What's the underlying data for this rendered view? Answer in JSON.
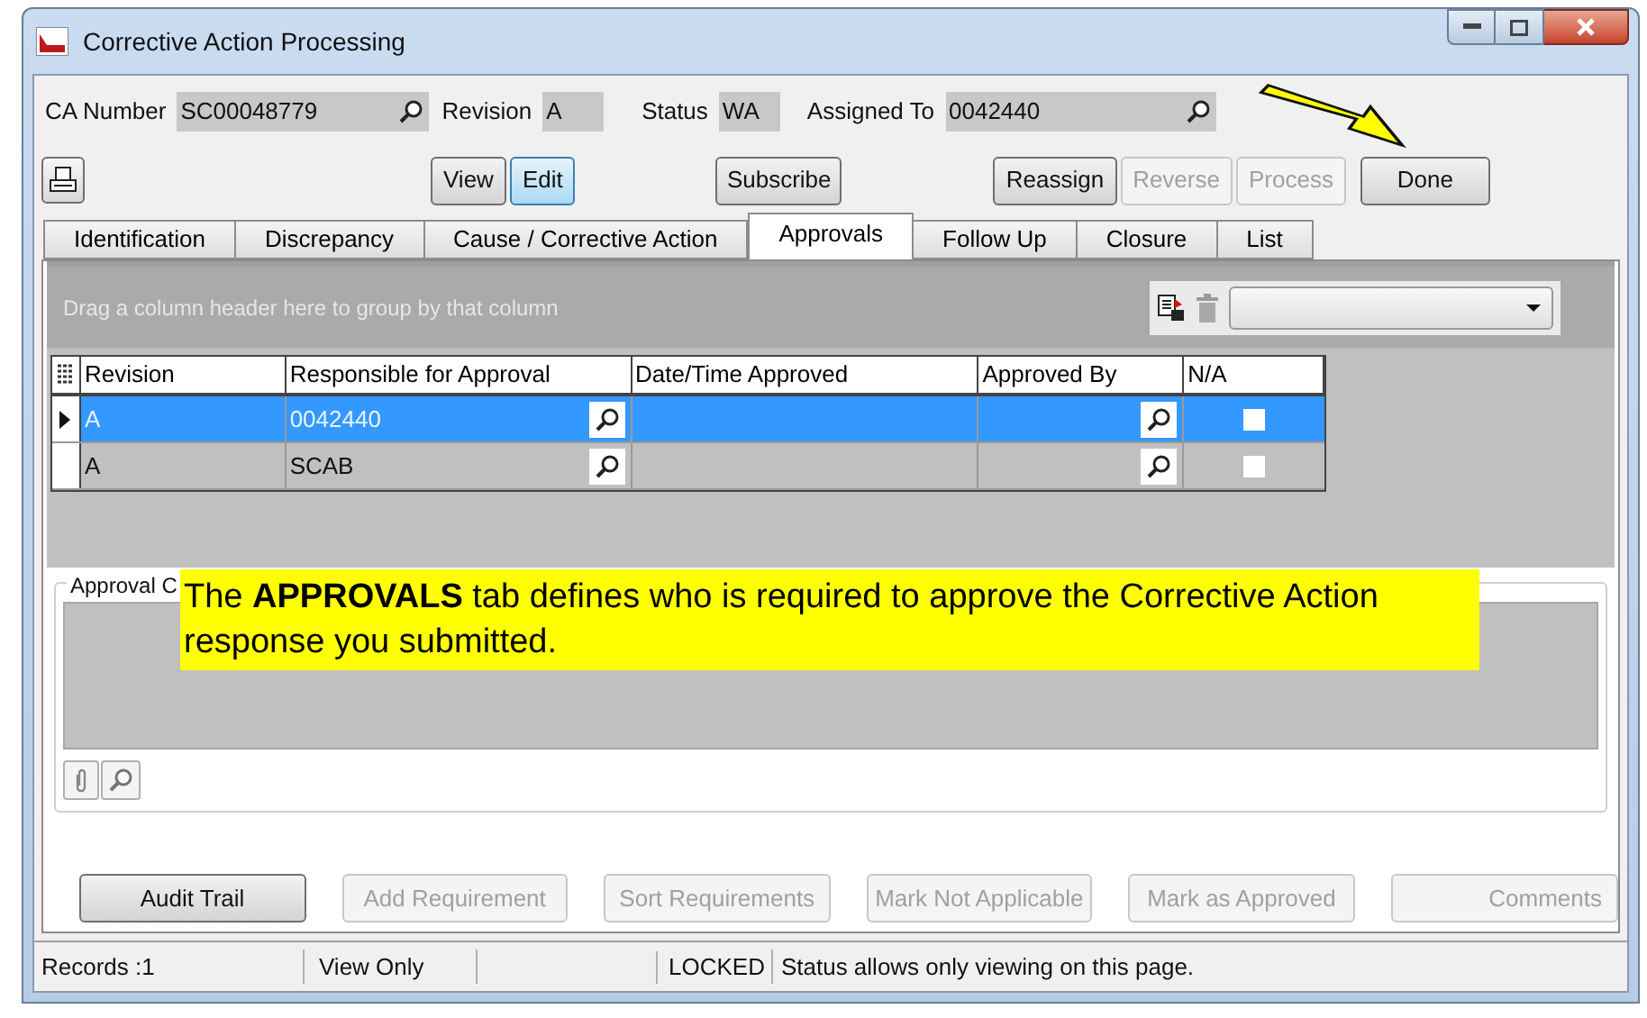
{
  "window": {
    "title": "Corrective Action Processing"
  },
  "header_fields": [
    {
      "label": "CA Number",
      "value": "SC00048779",
      "lookup": true
    },
    {
      "label": "Revision",
      "value": "A",
      "lookup": false
    },
    {
      "label": "Status",
      "value": "WA",
      "lookup": false
    },
    {
      "label": "Assigned To",
      "value": "0042440",
      "lookup": true
    }
  ],
  "toolbar_groups": [
    {
      "buttons": [
        {
          "label": "View",
          "selected": false,
          "disabled": false
        },
        {
          "label": "Edit",
          "selected": true,
          "disabled": false
        }
      ]
    },
    {
      "buttons": [
        {
          "label": "Subscribe",
          "selected": false,
          "disabled": false
        }
      ]
    },
    {
      "buttons": [
        {
          "label": "Reassign",
          "selected": false,
          "disabled": false
        },
        {
          "label": "Reverse",
          "selected": false,
          "disabled": true
        },
        {
          "label": "Process",
          "selected": false,
          "disabled": true
        }
      ]
    },
    {
      "buttons": [
        {
          "label": "Done",
          "selected": false,
          "disabled": false
        }
      ]
    }
  ],
  "tabs": [
    {
      "label": "Identification",
      "selected": false
    },
    {
      "label": "Discrepancy",
      "selected": false
    },
    {
      "label": "Cause / Corrective Action",
      "selected": false
    },
    {
      "label": "Approvals",
      "selected": true
    },
    {
      "label": "Follow Up",
      "selected": false
    },
    {
      "label": "Closure",
      "selected": false
    },
    {
      "label": "List",
      "selected": false
    }
  ],
  "group_panel": {
    "hint": "Drag a column header here to group by that column"
  },
  "table": {
    "columns": [
      "Revision",
      "Responsible for Approval",
      "Date/Time Approved",
      "Approved By",
      "N/A"
    ],
    "rows": [
      {
        "selected": true,
        "revision": "A",
        "responsible": "0042440",
        "date_time": "",
        "approved_by": "",
        "na_checked": false
      },
      {
        "selected": false,
        "revision": "A",
        "responsible": "SCAB",
        "date_time": "",
        "approved_by": "",
        "na_checked": false
      }
    ]
  },
  "comments": {
    "label": "Approval C"
  },
  "callout": {
    "text": "The **APPROVALS** tab defines who is required to approve the Corrective Action response you submitted."
  },
  "bottom_buttons": [
    {
      "label": "Audit Trail",
      "disabled": false
    },
    {
      "label": "Add Requirement",
      "disabled": true
    },
    {
      "label": "Sort Requirements",
      "disabled": true
    },
    {
      "label": "Mark Not Applicable",
      "disabled": true
    },
    {
      "label": "Mark as Approved",
      "disabled": true
    },
    {
      "label": "Comments",
      "disabled": true
    }
  ],
  "status_bar": [
    "Records :1",
    "View Only",
    "LOCKED",
    "Status allows only viewing on this page."
  ]
}
